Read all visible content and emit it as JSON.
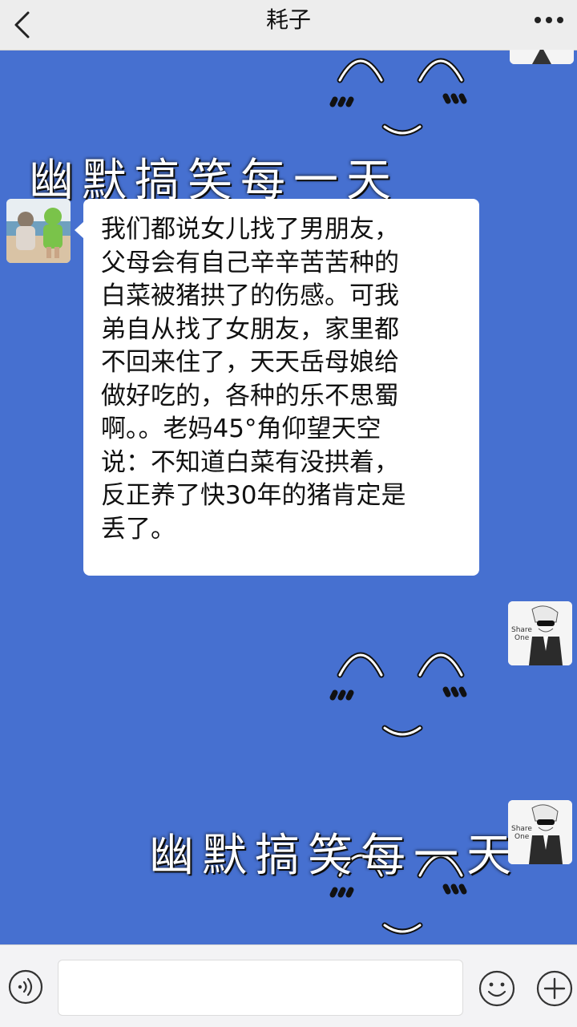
{
  "header": {
    "title": "耗子"
  },
  "icons": {
    "back": "chevron-left-icon",
    "more": "more-dots-icon",
    "voice": "voice-icon",
    "emoji": "emoji-icon",
    "plus": "plus-icon"
  },
  "messages": [
    {
      "sender": "contact",
      "lines": [
        "我们都说女儿找了男朋友，",
        "父母会有自己辛辛苦苦种的",
        "白菜被猪拱了的伤感。可我",
        "弟自从找了女朋友，家里都",
        "不回来住了，天天岳母娘给",
        "做好吃的，各种的乐不思蜀",
        "啊。。老妈45°角仰望天空",
        "说：不知道白菜有没拱着，",
        "反正养了快30年的猪肯定是",
        "丢了。"
      ]
    }
  ],
  "stickers": [
    {
      "text": "幽默搞笑每一天"
    },
    {
      "text": "幽默搞笑每一天"
    }
  ],
  "avatar_badge_text": [
    "Share",
    "One"
  ],
  "composer": {
    "value": ""
  },
  "colors": {
    "chat_background": "#4670d0",
    "bubble": "#ffffff",
    "topbar": "#ededed"
  }
}
